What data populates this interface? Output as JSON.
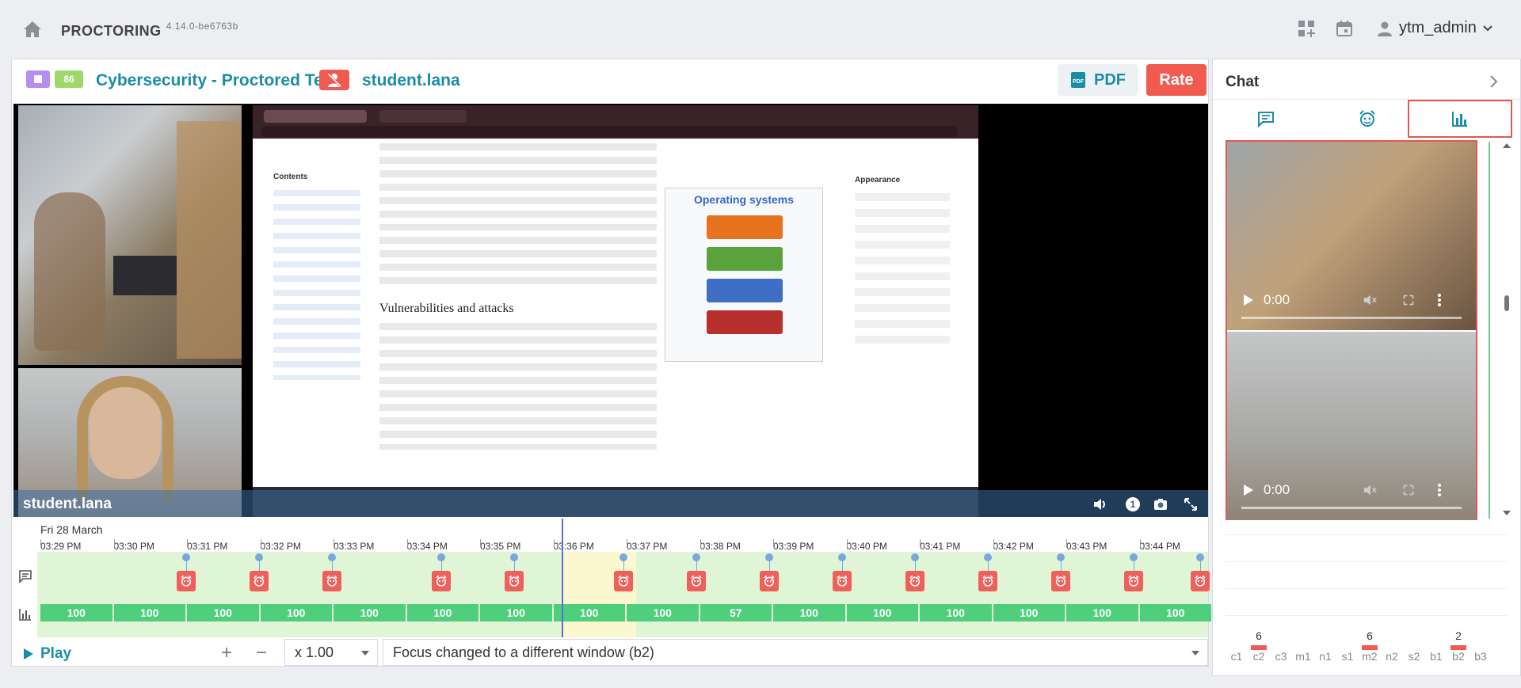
{
  "app": {
    "name": "PROCTORING",
    "version": "4.14.0-be6763b"
  },
  "user": {
    "name": "ytm_admin"
  },
  "header": {
    "badge_score": "86",
    "title": "Cybersecurity - Proctored Test",
    "student": "student.lana",
    "pdf_label": "PDF",
    "rate_label": "Rate"
  },
  "video": {
    "overlay_name": "student.lana",
    "count_badge": "1",
    "browser": {
      "wiki_os_title": "Operating systems",
      "wiki_heading": "Vulnerabilities and attacks",
      "wiki_contents": "Contents",
      "appearance": "Appearance"
    }
  },
  "timeline": {
    "date": "Fri 28 March",
    "times": [
      "03:29 PM",
      "03:30 PM",
      "03:31 PM",
      "03:32 PM",
      "03:33 PM",
      "03:34 PM",
      "03:35 PM",
      "03:36 PM",
      "03:37 PM",
      "03:38 PM",
      "03:39 PM",
      "03:40 PM",
      "03:41 PM",
      "03:42 PM",
      "03:43 PM",
      "03:44 PM"
    ],
    "scores": [
      "100",
      "100",
      "100",
      "100",
      "100",
      "100",
      "100",
      "100",
      "100",
      "57",
      "100",
      "100",
      "100",
      "100",
      "100",
      "100"
    ]
  },
  "controls": {
    "play_label": "Play",
    "speed": "x 1.00",
    "event": "Focus changed to a different window (b2)"
  },
  "chat": {
    "title": "Chat",
    "video_time_1": "0:00",
    "video_time_2": "0:00"
  },
  "chart_data": {
    "type": "bar",
    "categories": [
      "c1",
      "c2",
      "c3",
      "m1",
      "n1",
      "s1",
      "m2",
      "n2",
      "s2",
      "b1",
      "b2",
      "b3"
    ],
    "values": [
      0,
      6,
      0,
      0,
      0,
      0,
      6,
      0,
      0,
      0,
      2,
      0
    ],
    "title": "",
    "xlabel": "",
    "ylabel": "",
    "bar_color": "#f05a50"
  },
  "colors": {
    "accent": "#1b8ca8",
    "danger": "#f05a50",
    "ok": "#4fcf7c"
  }
}
